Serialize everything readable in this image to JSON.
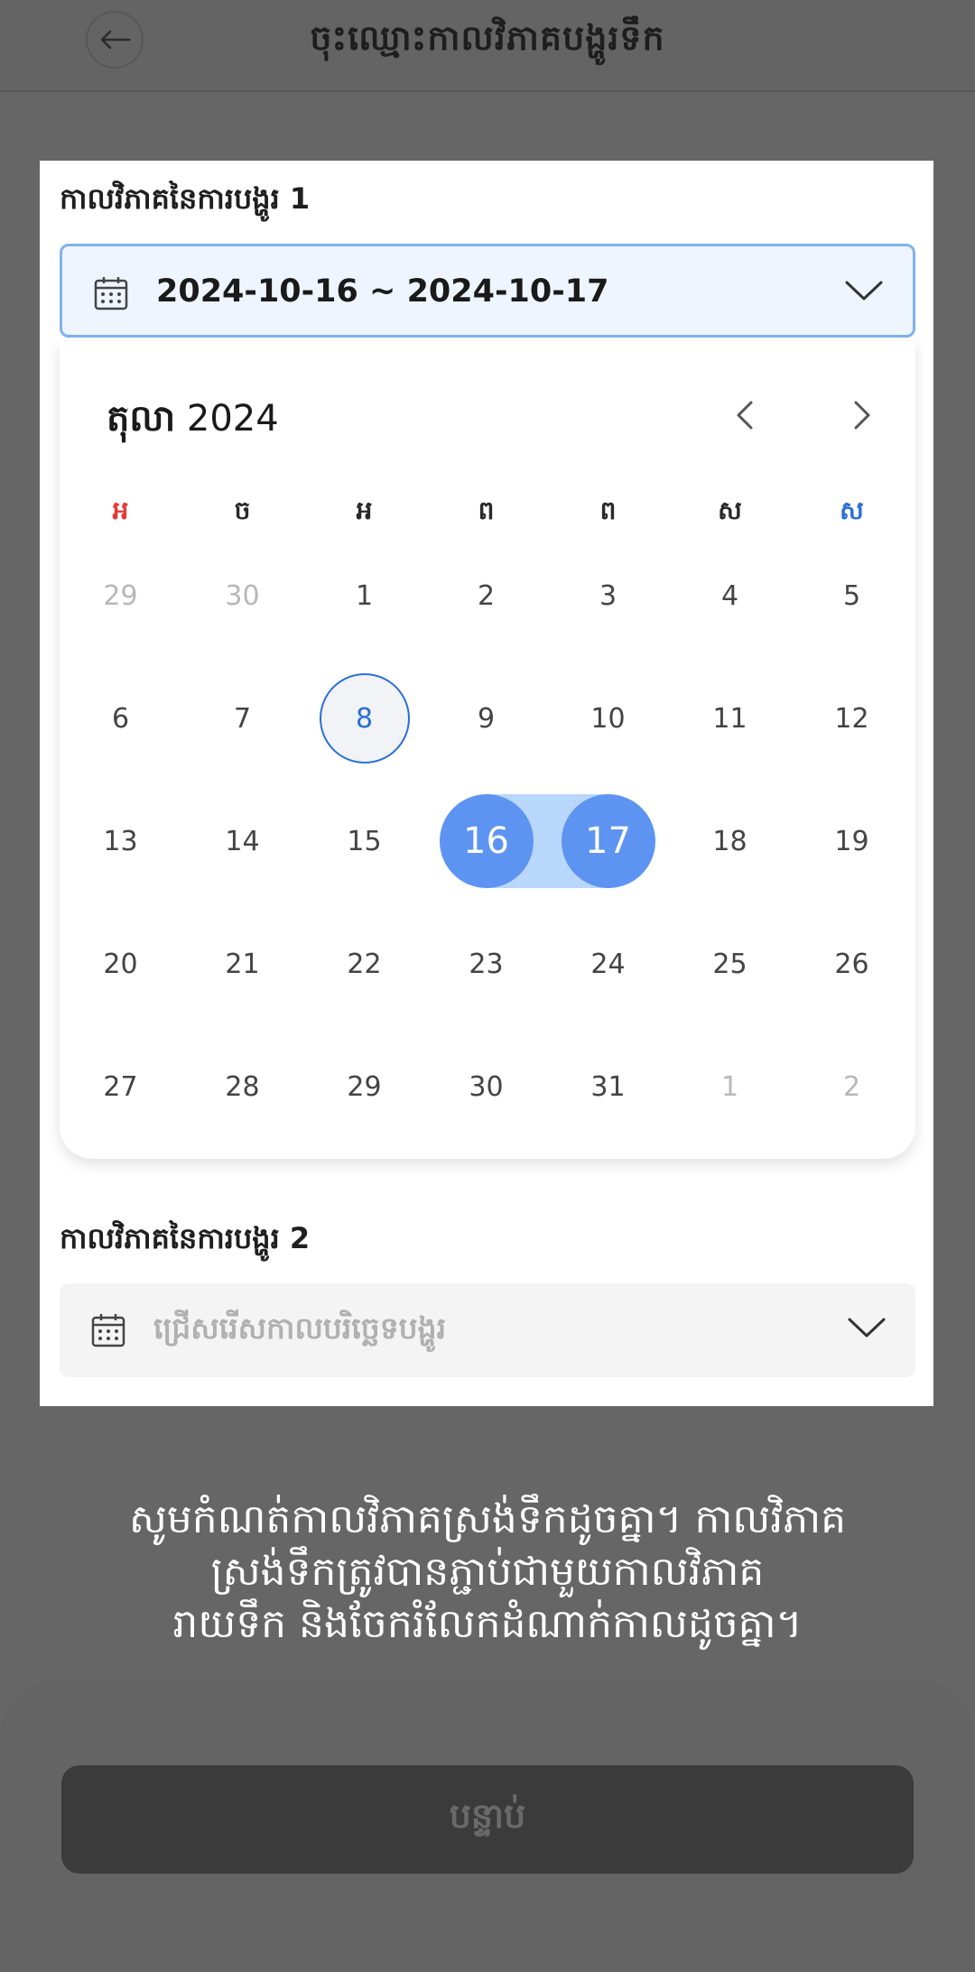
{
  "header": {
    "title": "ចុះឈ្មោះកាលវិភាគបង្ហូរទឹក",
    "back_icon": "arrow-left-icon"
  },
  "section1": {
    "label": "កាលវិភាគនៃការបង្ហូរ 1",
    "select_value": "2024-10-16 ~ 2024-10-17",
    "icon": "calendar-icon"
  },
  "calendar": {
    "month_name": "តុលា",
    "year": "2024",
    "weekdays": [
      "អ",
      "ច",
      "អ",
      "ព",
      "ព",
      "ស",
      "ស"
    ],
    "weekday_colors": [
      "#e53935",
      "#2a2a2a",
      "#2a2a2a",
      "#2a2a2a",
      "#2a2a2a",
      "#2a2a2a",
      "#2a6fd6"
    ],
    "weeks": [
      [
        "29",
        "30",
        "1",
        "2",
        "3",
        "4",
        "5"
      ],
      [
        "6",
        "7",
        "8",
        "9",
        "10",
        "11",
        "12"
      ],
      [
        "13",
        "14",
        "15",
        "16",
        "17",
        "18",
        "19"
      ],
      [
        "20",
        "21",
        "22",
        "23",
        "24",
        "25",
        "26"
      ],
      [
        "27",
        "28",
        "29",
        "30",
        "31",
        "1",
        "2"
      ]
    ],
    "today": "8",
    "range_start": "16",
    "range_end": "17",
    "accent_color": "#5d94f2"
  },
  "section2": {
    "label": "កាលវិភាគនៃការបង្ហូរ 2",
    "placeholder": "ជ្រើសរើសកាលបរិច្ឆេទបង្ហូរ",
    "icon": "calendar-icon"
  },
  "notice": {
    "line1": "សូមកំណត់កាលវិភាគស្រង់ទឹកដូចគ្នា។ កាលវិភាគ",
    "line2": "ស្រង់ទឹកត្រូវបានភ្ជាប់ជាមួយកាលវិភាគ",
    "line3": "រាយទឹក និងចែករំលែកដំណាក់កាលដូចគ្នា។"
  },
  "footer": {
    "next_label": "បន្ទាប់"
  }
}
